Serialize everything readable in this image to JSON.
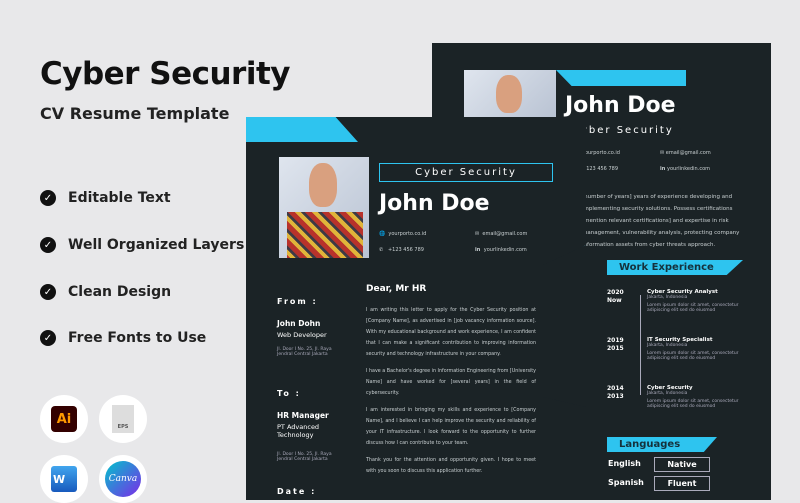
{
  "promo": {
    "title": "Cyber Security",
    "subtitle": "CV Resume Template",
    "features": [
      "Editable Text",
      "Well Organized Layers",
      "Clean Design",
      "Free Fonts to Use"
    ],
    "formats": [
      {
        "label": "Ai",
        "icon": "adobe-illustrator-icon"
      },
      {
        "label": "EPS",
        "icon": "eps-file-icon"
      },
      {
        "label": "W",
        "icon": "microsoft-word-icon"
      },
      {
        "label": "Canva",
        "icon": "canva-icon"
      }
    ]
  },
  "accent": "#2ec4ef",
  "page_bg": "#1b2326",
  "back": {
    "name": "John Doe",
    "role": "Cyber Security",
    "website": "yourporto.co.id",
    "email": "email@gmail.com",
    "phone": "+123 456 789",
    "linkedin": "yourlinkedin.com",
    "summary": "[number of years] years of experience developing and implementing security solutions. Possess certifications [mention relevant certifications] and expertise in risk management, vulnerability analysis, protecting company information assets from cyber threats approach.",
    "work_title": "Work Experience",
    "jobs": [
      {
        "years": [
          "2020",
          "Now"
        ],
        "title": "Cyber Security Analyst",
        "place": "Jakarta, Indonesia",
        "desc": "Lorem ipsum dolor sit amet, consectetur adipiscing elit sed do eiusmod"
      },
      {
        "years": [
          "2019",
          "2015"
        ],
        "title": "IT Security Specialist",
        "place": "Jakarta, Indonesia",
        "desc": "Lorem ipsum dolor sit amet, consectetur adipiscing elit sed do eiusmod"
      },
      {
        "years": [
          "2014",
          "2013"
        ],
        "title": "Cyber Security",
        "place": "Jakarta, Indonesia",
        "desc": "Lorem ipsum dolor sit amet, consectetur adipiscing elit sed do eiusmod"
      }
    ],
    "lang_title": "Languages",
    "languages": [
      {
        "name": "English",
        "level": "Native"
      },
      {
        "name": "Spanish",
        "level": "Fluent"
      }
    ]
  },
  "front": {
    "role": "Cyber Security",
    "name": "John Doe",
    "website": "yourporto.co.id",
    "phone": "+123 456 789",
    "email": "email@gmail.com",
    "linkedin": "yourlinkedin.com",
    "from_label": "From :",
    "from_name": "John Dohn",
    "from_title": "Web Developer",
    "from_addr": "Jl. Door I No. 25, Jl. Raya Jendral Central Jakarta",
    "to_label": "To :",
    "to_name": "HR Manager",
    "to_company": "PT Advanced Technology",
    "to_addr": "Jl. Door I No. 25, Jl. Raya Jendral Central Jakarta",
    "date_label": "Date :",
    "greeting": "Dear, Mr HR",
    "paragraphs": [
      "I am writing this letter to apply for the Cyber Security position at [Company Name], as advertised in [job vacancy information source]. With my educational background and work experience, I am confident that I can make a significant contribution to improving information security and technology infrastructure in your company.",
      "I have a Bachelor's degree in Information Engineering from [University Name] and have worked for [several years] in the field of cybersecurity.",
      "I am interested in bringing my skills and experience to [Company Name], and I believe I can help improve the security and reliability of your IT infrastructure. I look forward to the opportunity to further discuss how I can contribute to your team.",
      "Thank you for the attention and opportunity given. I hope to meet with you soon to discuss this application further."
    ]
  }
}
